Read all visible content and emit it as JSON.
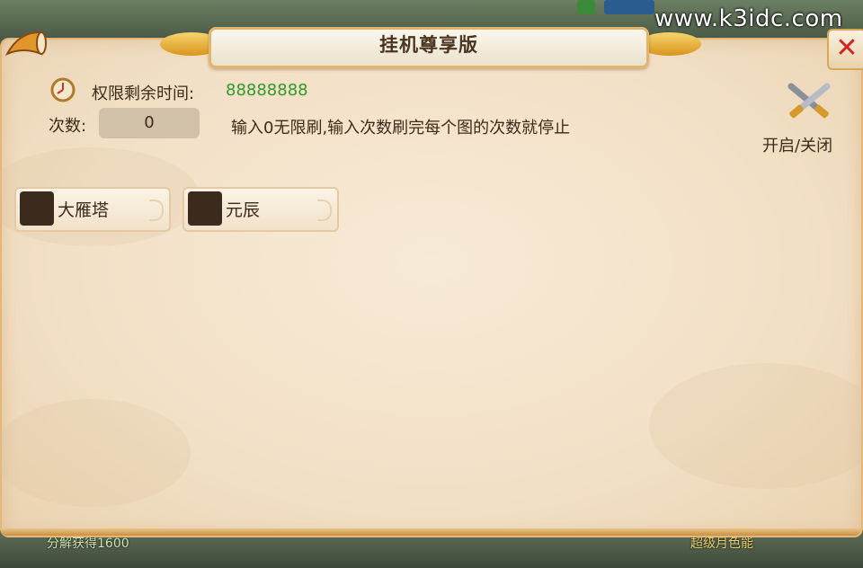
{
  "watermark": "www.k3idc.com",
  "panel": {
    "title": "挂机尊享版"
  },
  "close_label": "✕",
  "time": {
    "label": "权限剩余时间:",
    "value": "88888888"
  },
  "count": {
    "label": "次数:",
    "value": "0"
  },
  "hint": "输入0无限刷,输入次数刷完每个图的次数就停止",
  "toggle": {
    "label": "开启/关闭"
  },
  "maps": [
    {
      "label": "大雁塔"
    },
    {
      "label": "元辰"
    }
  ],
  "background": {
    "bottom_left_text": "分解获得1600",
    "bottom_right_text": "超级月色能"
  },
  "colors": {
    "accent_gold": "#e2b56a",
    "time_green": "#2f9a2a",
    "close_red": "#d1231f",
    "panel_bg": "#f2e0c6"
  },
  "icons": {
    "clock": "clock-icon",
    "toggle": "crossed-swords-icon",
    "close": "close-icon",
    "horn": "horn-icon"
  }
}
